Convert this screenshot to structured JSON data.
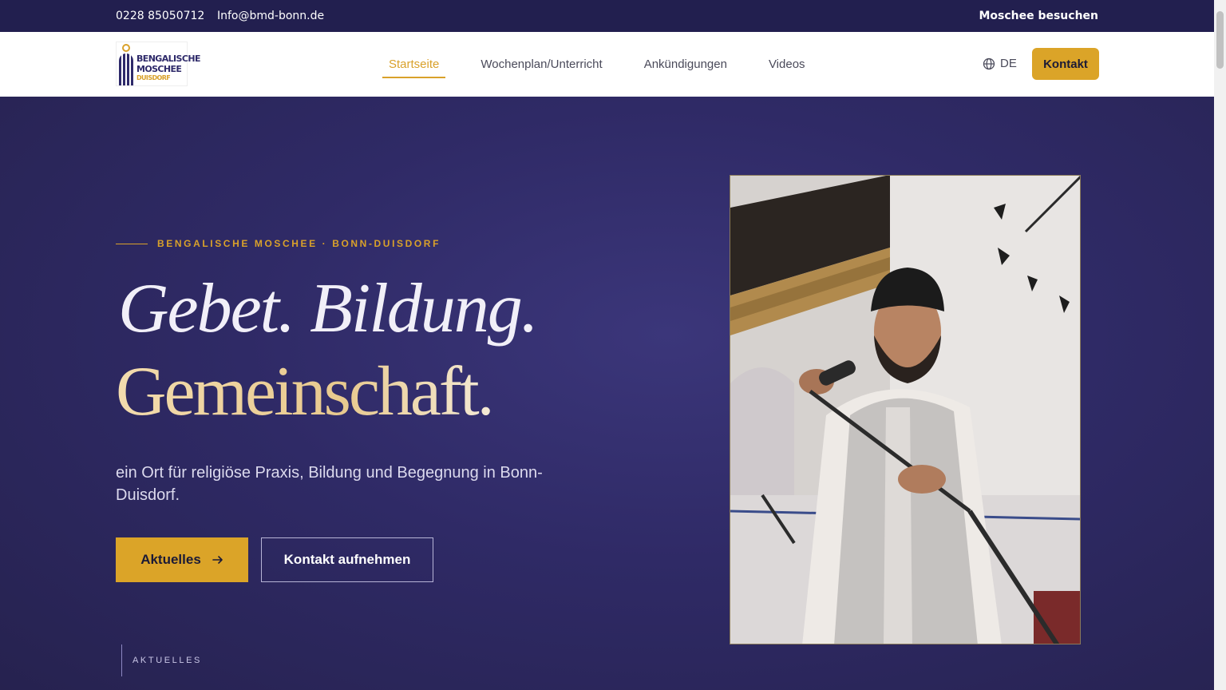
{
  "topbar": {
    "phone": "0228 85050712",
    "email": "Info@bmd-bonn.de",
    "visit_link": "Moschee besuchen"
  },
  "logo": {
    "line1": "BENGALISCHE",
    "line2": "MOSCHEE",
    "line3": "DUISDORF"
  },
  "nav": {
    "items": [
      {
        "label": "Startseite",
        "active": true
      },
      {
        "label": "Wochenplan/Unterricht",
        "active": false
      },
      {
        "label": "Ankündigungen",
        "active": false
      },
      {
        "label": "Videos",
        "active": false
      }
    ],
    "language": "DE",
    "contact_button": "Kontakt"
  },
  "hero": {
    "eyebrow": "BENGALISCHE MOSCHEE · BONN-DUISDORF",
    "headline_line1": "Gebet. Bildung.",
    "headline_line2": "Gemeinschaft.",
    "lead": "ein Ort für religiöse Praxis, Bildung und Begegnung in Bonn-Duisdorf.",
    "primary_button": "Aktuelles",
    "secondary_button": "Kontakt aufnehmen",
    "news_tab": "AKTUELLES"
  },
  "colors": {
    "accent": "#dba428",
    "navy": "#221f4f",
    "hero_bg": "#2f2a66"
  },
  "icons": {
    "globe": "globe-icon",
    "arrow": "arrow-right-icon"
  }
}
